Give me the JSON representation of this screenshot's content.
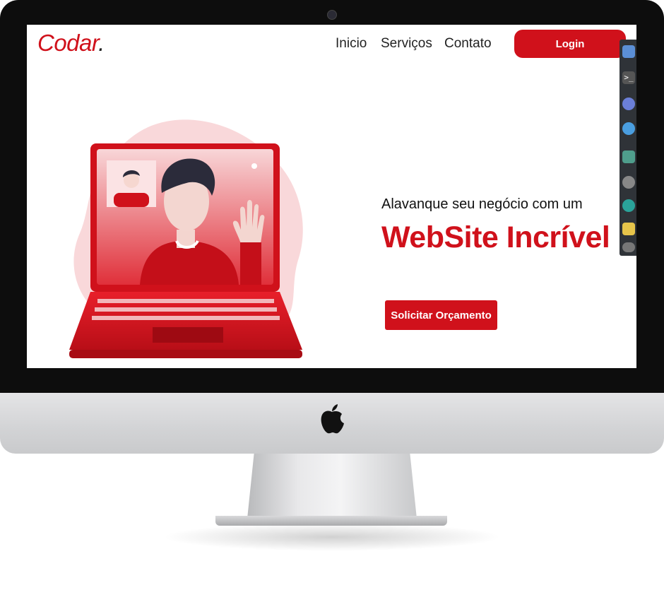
{
  "site": {
    "logo": "Codar",
    "logo_dot": "."
  },
  "nav": {
    "items": [
      "Inicio",
      "Serviços",
      "Contato"
    ],
    "login_label": "Login"
  },
  "hero": {
    "subtitle": "Alavanque seu negócio com um",
    "headline": "WebSite Incrível",
    "cta_label": "Solicitar Orçamento"
  },
  "colors": {
    "brand": "#d0111b",
    "text": "#222222",
    "bezel": "#0d0d0d"
  },
  "dock_icons": [
    "app-icon",
    "terminal-icon",
    "browser-icon",
    "search-icon",
    "files-icon",
    "disk-icon",
    "settings-icon",
    "notes-icon",
    "toggle-icon"
  ]
}
